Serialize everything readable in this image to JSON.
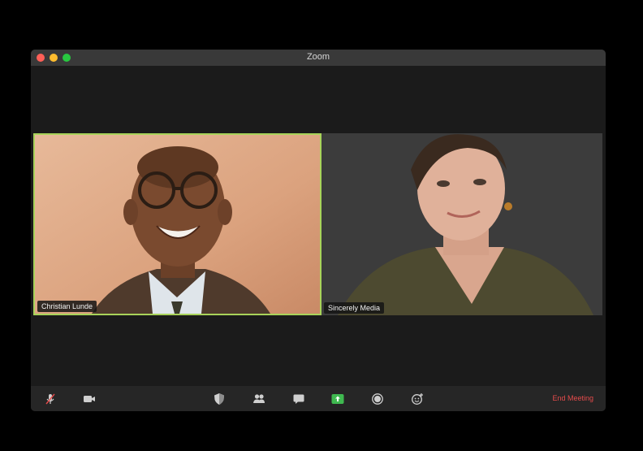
{
  "window": {
    "title": "Zoom"
  },
  "participants": [
    {
      "name": "Christian Lunde",
      "active_speaker": true
    },
    {
      "name": "Sincerely Media",
      "active_speaker": false
    }
  ],
  "toolbar": {
    "mute_icon": "microphone-muted-icon",
    "video_icon": "video-camera-icon",
    "security_icon": "shield-icon",
    "participants_icon": "participants-icon",
    "chat_icon": "chat-bubble-icon",
    "share_icon": "share-screen-icon",
    "record_icon": "record-icon",
    "reactions_icon": "reaction-icon",
    "end_meeting_label": "End Meeting"
  },
  "colors": {
    "active_speaker_border": "#a8d35a",
    "share_button": "#3fb950",
    "end_meeting": "#e54b4b"
  }
}
